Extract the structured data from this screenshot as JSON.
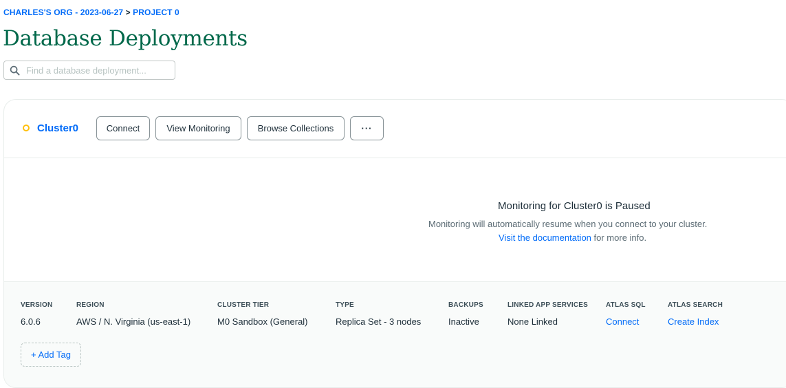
{
  "breadcrumb": {
    "org": "CHARLES'S ORG - 2023-06-27",
    "separator": ">",
    "project": "PROJECT 0"
  },
  "page_title": "Database Deployments",
  "search": {
    "placeholder": "Find a database deployment...",
    "value": "",
    "icon": "search-icon"
  },
  "cluster": {
    "name": "Cluster0",
    "status_color": "#ffc010",
    "buttons": {
      "connect": "Connect",
      "view_monitoring": "View Monitoring",
      "browse_collections": "Browse Collections",
      "more": "···"
    },
    "monitoring": {
      "title": "Monitoring for Cluster0 is Paused",
      "subtitle": "Monitoring will automatically resume when you connect to your cluster.",
      "doc_link": "Visit the documentation",
      "doc_suffix": " for more info."
    },
    "details": [
      {
        "label": "VERSION",
        "value": "6.0.6"
      },
      {
        "label": "REGION",
        "value": "AWS / N. Virginia (us-east-1)"
      },
      {
        "label": "CLUSTER TIER",
        "value": "M0 Sandbox (General)"
      },
      {
        "label": "TYPE",
        "value": "Replica Set - 3 nodes"
      },
      {
        "label": "BACKUPS",
        "value": "Inactive"
      },
      {
        "label": "LINKED APP SERVICES",
        "value": "None Linked"
      },
      {
        "label": "ATLAS SQL",
        "value": "Connect"
      },
      {
        "label": "ATLAS SEARCH",
        "value": "Create Index"
      }
    ],
    "add_tag": "+ Add Tag"
  },
  "colors": {
    "accent": "#016bf8",
    "title_green": "#00684a",
    "status_yellow": "#ffc010"
  }
}
